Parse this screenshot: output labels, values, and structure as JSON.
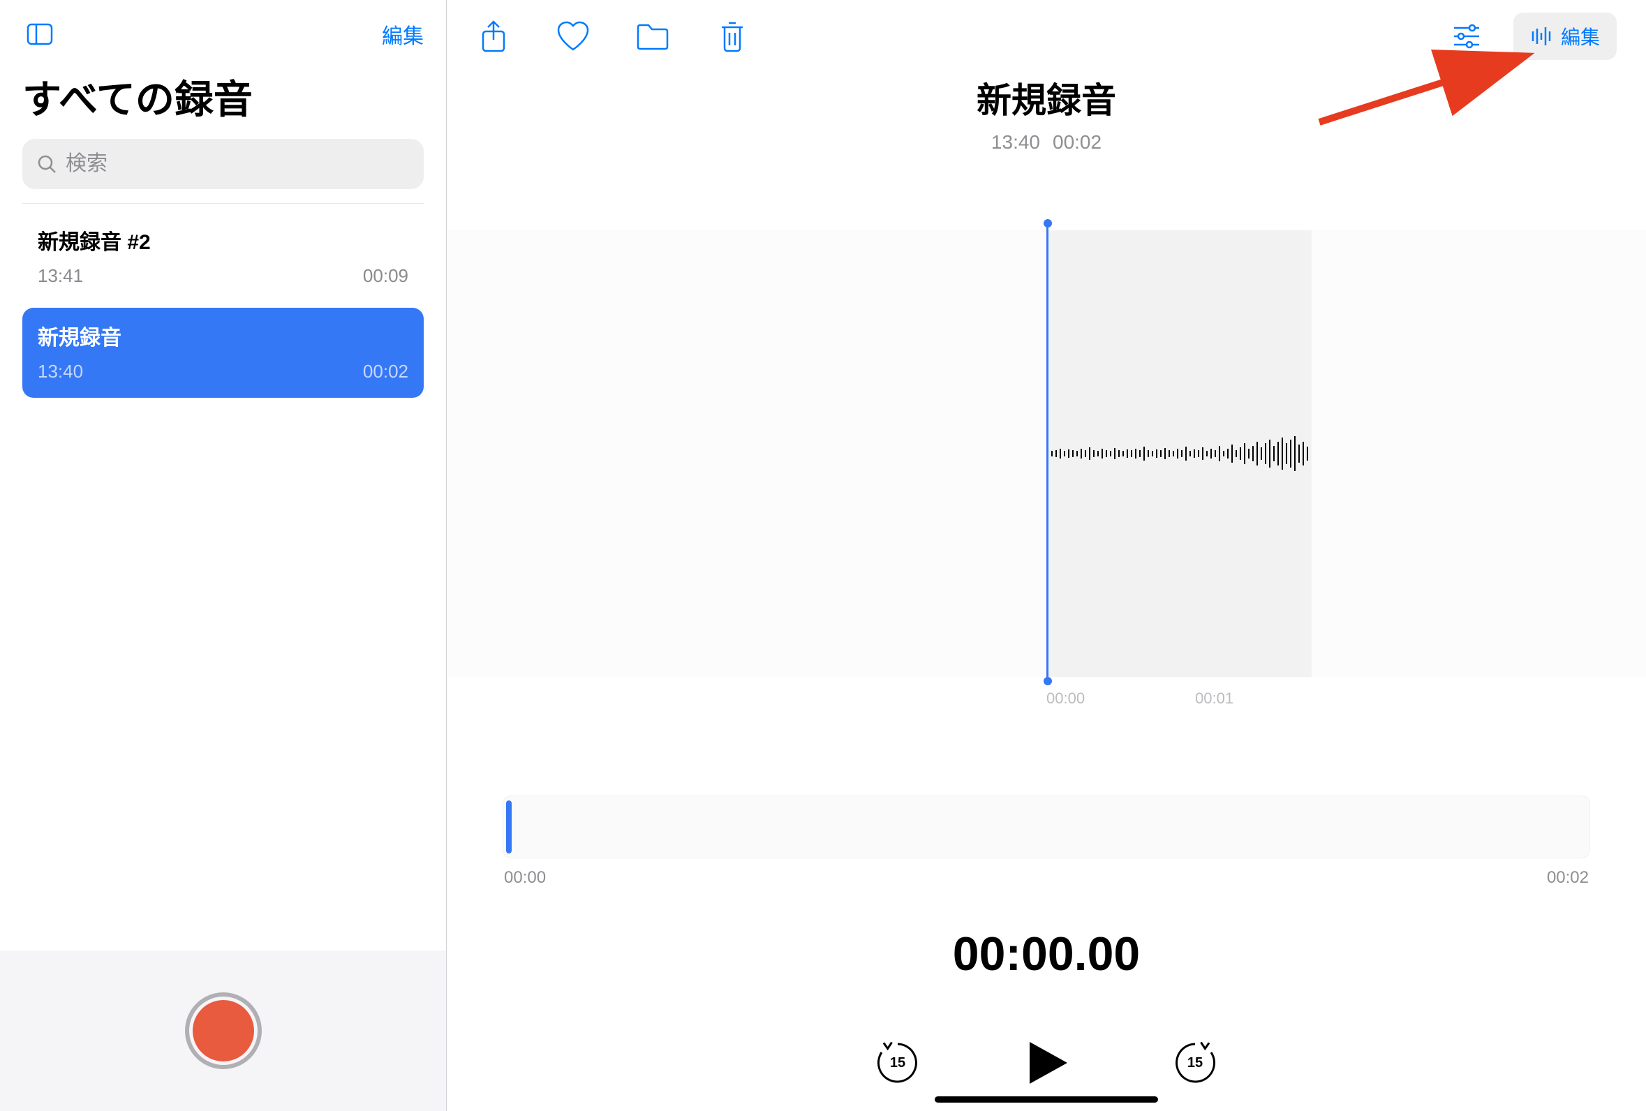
{
  "sidebar": {
    "edit_label": "編集",
    "title": "すべての録音",
    "search_placeholder": "検索",
    "items": [
      {
        "title": "新規録音 #2",
        "time": "13:41",
        "duration": "00:09",
        "selected": false
      },
      {
        "title": "新規録音",
        "time": "13:40",
        "duration": "00:02",
        "selected": true
      }
    ]
  },
  "main": {
    "title": "新規録音",
    "time": "13:40",
    "duration": "00:02",
    "edit_button_label": "編集",
    "waveform_ticks": [
      "00:00",
      "00:01"
    ],
    "mini_start": "00:00",
    "mini_end": "00:02",
    "current_time": "00:00.00",
    "skip_seconds": "15"
  },
  "colors": {
    "accent": "#007aff",
    "record": "#e85b3f"
  }
}
